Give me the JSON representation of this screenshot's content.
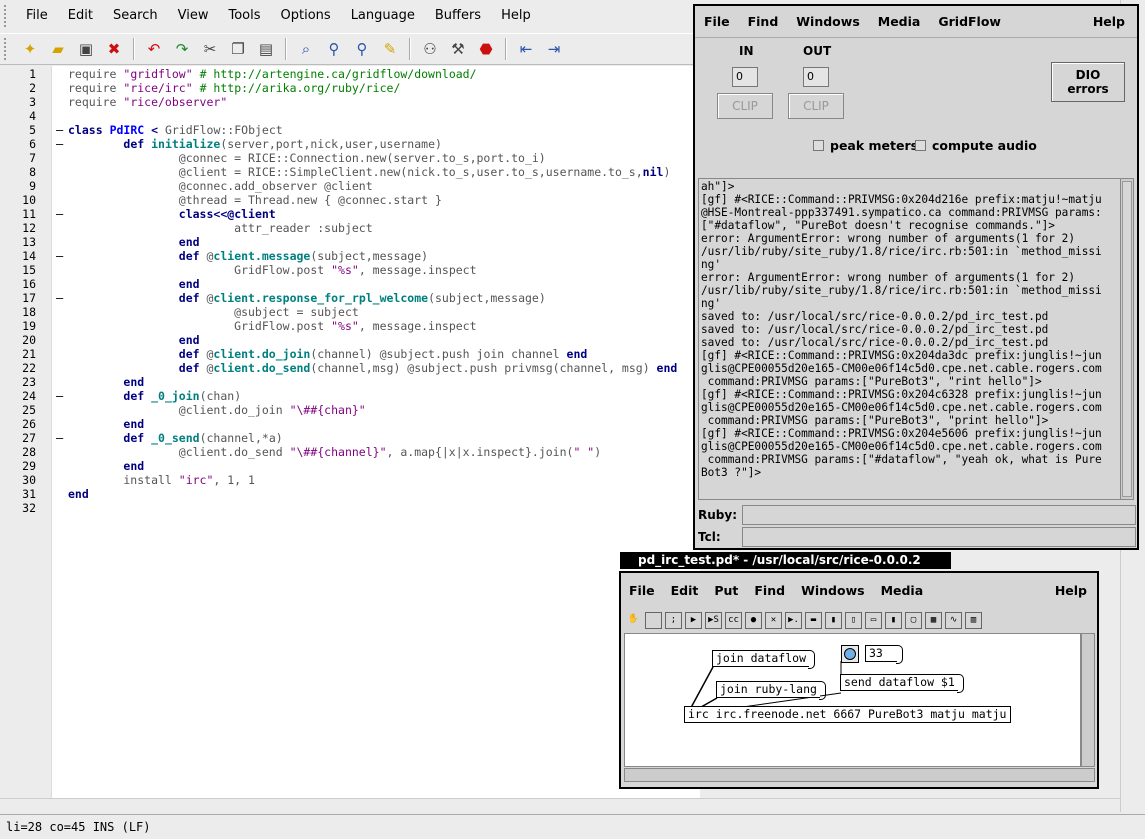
{
  "editor": {
    "menu": [
      "File",
      "Edit",
      "Search",
      "View",
      "Tools",
      "Options",
      "Language",
      "Buffers",
      "Help"
    ],
    "toolbar_icons": [
      "new-file-icon",
      "open-folder-icon",
      "save-icon",
      "close-icon",
      "undo-icon",
      "redo-icon",
      "cut-icon",
      "copy-icon",
      "paste-icon",
      "find-icon",
      "zoom-in-icon",
      "zoom-out-icon",
      "replace-icon",
      "find-in-files-icon",
      "build-icon",
      "stop-icon",
      "previous-buffer-icon",
      "next-buffer-icon"
    ],
    "status": "li=28 co=45 INS (LF)",
    "lines": [
      {
        "n": "1",
        "fold": "",
        "html": "require <span class=\"str\">\"gridflow\"</span> <span class=\"cmt\"># http://artengine.ca/gridflow/download/</span>"
      },
      {
        "n": "2",
        "fold": "",
        "html": "require <span class=\"str\">\"rice/irc\"</span> <span class=\"cmt\"># http://arika.org/ruby/rice/</span>"
      },
      {
        "n": "3",
        "fold": "",
        "html": "require <span class=\"str\">\"rice/observer\"</span>"
      },
      {
        "n": "4",
        "fold": "",
        "html": ""
      },
      {
        "n": "5",
        "fold": "–",
        "html": "<span class=\"kw\">class</span> <span class=\"cls\">PdIRC</span> <span class=\"kw\">&lt;</span> GridFlow::FObject"
      },
      {
        "n": "6",
        "fold": "–",
        "html": "        <span class=\"kw\">def</span> <span class=\"mth\">initialize</span>(server,port,nick,user,username)"
      },
      {
        "n": "7",
        "fold": "",
        "html": "                @connec = RICE::Connection.new(server.to_s,port.to_i)"
      },
      {
        "n": "8",
        "fold": "",
        "html": "                @client = RICE::SimpleClient.new(nick.to_s,user.to_s,username.to_s,<span class=\"kw\">nil</span>)"
      },
      {
        "n": "9",
        "fold": "",
        "html": "                @connec.add_observer @client"
      },
      {
        "n": "10",
        "fold": "",
        "html": "                @thread = Thread.new { @connec.start }"
      },
      {
        "n": "11",
        "fold": "–",
        "html": "                <span class=\"kw\">class</span><span class=\"kw\">&lt;&lt;</span><span class=\"kw\">@client</span>"
      },
      {
        "n": "12",
        "fold": "",
        "html": "                        attr_reader :subject"
      },
      {
        "n": "13",
        "fold": "",
        "html": "                <span class=\"kw\">end</span>"
      },
      {
        "n": "14",
        "fold": "–",
        "html": "                <span class=\"kw\">def</span> @<span class=\"mth\">client.message</span>(subject,message)"
      },
      {
        "n": "15",
        "fold": "",
        "html": "                        GridFlow.post <span class=\"str\">\"%s\"</span>, message.inspect"
      },
      {
        "n": "16",
        "fold": "",
        "html": "                <span class=\"kw\">end</span>"
      },
      {
        "n": "17",
        "fold": "–",
        "html": "                <span class=\"kw\">def</span> @<span class=\"mth\">client.response_for_rpl_welcome</span>(subject,message)"
      },
      {
        "n": "18",
        "fold": "",
        "html": "                        @subject = subject"
      },
      {
        "n": "19",
        "fold": "",
        "html": "                        GridFlow.post <span class=\"str\">\"%s\"</span>, message.inspect"
      },
      {
        "n": "20",
        "fold": "",
        "html": "                <span class=\"kw\">end</span>"
      },
      {
        "n": "21",
        "fold": "",
        "html": "                <span class=\"kw\">def</span> @<span class=\"mth\">client.do_join</span>(channel) @subject.push join channel <span class=\"kw\">end</span>"
      },
      {
        "n": "22",
        "fold": "",
        "html": "                <span class=\"kw\">def</span> @<span class=\"mth\">client.do_send</span>(channel,msg) @subject.push privmsg(channel, msg) <span class=\"kw\">end</span>"
      },
      {
        "n": "23",
        "fold": "",
        "html": "        <span class=\"kw\">end</span>"
      },
      {
        "n": "24",
        "fold": "–",
        "html": "        <span class=\"kw\">def</span> <span class=\"mth\">_0_join</span>(chan)"
      },
      {
        "n": "25",
        "fold": "",
        "html": "                @client.do_join <span class=\"str\">\"\\##{chan}\"</span>"
      },
      {
        "n": "26",
        "fold": "",
        "html": "        <span class=\"kw\">end</span>"
      },
      {
        "n": "27",
        "fold": "–",
        "html": "        <span class=\"kw\">def</span> <span class=\"mth\">_0_send</span>(channel,*a)"
      },
      {
        "n": "28",
        "fold": "",
        "html": "                @client.do_send <span class=\"str\">\"\\##{channel}\"</span>, a.map{|x|x.inspect}.join(<span class=\"str\">\" \"</span>)"
      },
      {
        "n": "29",
        "fold": "",
        "html": "        <span class=\"kw\">end</span>"
      },
      {
        "n": "30",
        "fold": "",
        "html": "        install <span class=\"str\">\"irc\"</span>, 1, 1"
      },
      {
        "n": "31",
        "fold": "",
        "html": "<span class=\"kw\">end</span>"
      },
      {
        "n": "32",
        "fold": "",
        "html": ""
      }
    ]
  },
  "pd_main": {
    "menu": [
      "File",
      "Find",
      "Windows",
      "Media",
      "GridFlow"
    ],
    "help": "Help",
    "in_label": "IN",
    "out_label": "OUT",
    "in_value": "0",
    "out_value": "0",
    "clip_label": "CLIP",
    "dio_line1": "DIO",
    "dio_line2": "errors",
    "peak_meters": "peak meters",
    "compute_audio": "compute audio",
    "ruby_label": "Ruby:",
    "tcl_label": "Tcl:",
    "console": [
      "ah\"]>",
      "[gf] #<RICE::Command::PRIVMSG:0x204d216e prefix:matju!~matju",
      "@HSE-Montreal-ppp337491.sympatico.ca command:PRIVMSG params:",
      "[\"#dataflow\", \"PureBot doesn't recognise commands.\"]>",
      "error: ArgumentError: wrong number of arguments(1 for 2)",
      "/usr/lib/ruby/site_ruby/1.8/rice/irc.rb:501:in `method_missi",
      "ng'",
      "error: ArgumentError: wrong number of arguments(1 for 2)",
      "/usr/lib/ruby/site_ruby/1.8/rice/irc.rb:501:in `method_missi",
      "ng'",
      "saved to: /usr/local/src/rice-0.0.0.2/pd_irc_test.pd",
      "saved to: /usr/local/src/rice-0.0.0.2/pd_irc_test.pd",
      "saved to: /usr/local/src/rice-0.0.0.2/pd_irc_test.pd",
      "[gf] #<RICE::Command::PRIVMSG:0x204da3dc prefix:junglis!~jun",
      "glis@CPE00055d20e165-CM00e06f14c5d0.cpe.net.cable.rogers.com",
      " command:PRIVMSG params:[\"PureBot3\", \"rint hello\"]>",
      "[gf] #<RICE::Command::PRIVMSG:0x204c6328 prefix:junglis!~jun",
      "glis@CPE00055d20e165-CM00e06f14c5d0.cpe.net.cable.rogers.com",
      " command:PRIVMSG params:[\"PureBot3\", \"print hello\"]>",
      "[gf] #<RICE::Command::PRIVMSG:0x204e5606 prefix:junglis!~jun",
      "glis@CPE00055d20e165-CM00e06f14c5d0.cpe.net.cable.rogers.com",
      " command:PRIVMSG params:[\"#dataflow\", \"yeah ok, what is Pure",
      "Bot3 ?\"]>"
    ]
  },
  "patch": {
    "title": "pd_irc_test.pd* - /usr/local/src/rice-0.0.0.2",
    "menu": [
      "File",
      "Edit",
      "Put",
      "Find",
      "Windows",
      "Media"
    ],
    "help": "Help",
    "toolbar": [
      "",
      "",
      ";",
      "▶",
      "▶S",
      "cc",
      "●",
      "✕",
      "▶.",
      "▬",
      "▮",
      "▯",
      "▭",
      "▮",
      "▢",
      "▦",
      "∿",
      "▥"
    ],
    "objects": {
      "join_dataflow": "join dataflow",
      "join_ruby": "join ruby-lang",
      "number": "33",
      "send_dataflow": "send dataflow $1",
      "irc": "irc irc.freenode.net 6667 PureBot3 matju matju"
    }
  }
}
